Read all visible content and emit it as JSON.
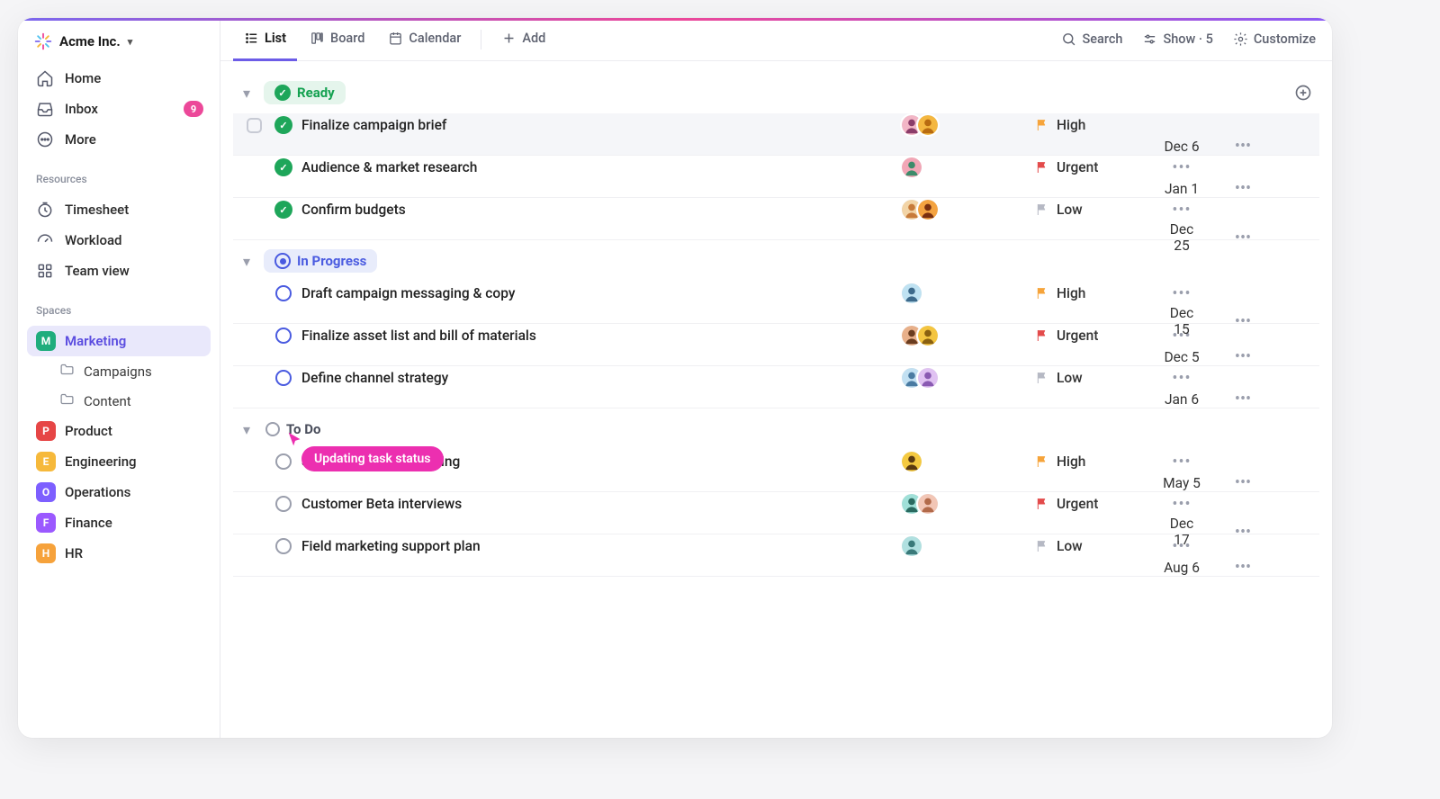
{
  "workspace": {
    "name": "Acme Inc."
  },
  "nav": {
    "home": "Home",
    "inbox": "Inbox",
    "inbox_badge": "9",
    "more": "More"
  },
  "sections": {
    "resources": "Resources",
    "spaces": "Spaces"
  },
  "resources": {
    "timesheet": "Timesheet",
    "workload": "Workload",
    "teamview": "Team view"
  },
  "spaces": [
    {
      "label": "Marketing",
      "initial": "M",
      "color": "#1fad7d",
      "active": true,
      "children": [
        "Campaigns",
        "Content"
      ]
    },
    {
      "label": "Product",
      "initial": "P",
      "color": "#e64646"
    },
    {
      "label": "Engineering",
      "initial": "E",
      "color": "#f6b93b"
    },
    {
      "label": "Operations",
      "initial": "O",
      "color": "#7d5fff"
    },
    {
      "label": "Finance",
      "initial": "F",
      "color": "#9b59ff"
    },
    {
      "label": "HR",
      "initial": "H",
      "color": "#f6a23b"
    }
  ],
  "toolbar": {
    "views": {
      "list": "List",
      "board": "Board",
      "calendar": "Calendar",
      "add": "Add"
    },
    "search": "Search",
    "show": "Show · 5",
    "customize": "Customize"
  },
  "groups": [
    {
      "key": "ready",
      "label": "Ready",
      "style": "ready",
      "icon": "check",
      "tasks": [
        {
          "title": "Finalize campaign brief",
          "avatars": [
            "#f2b6c6|#8b3d6a",
            "#f4b740|#b86b11"
          ],
          "priority": "High",
          "prio_color": "#f6a43b",
          "date": "Dec 6",
          "selected": true,
          "status": "done"
        },
        {
          "title": "Audience & market research",
          "avatars": [
            "#f2a6b6|#3d8b6a"
          ],
          "priority": "Urgent",
          "prio_color": "#e34b4b",
          "date": "Jan 1",
          "has_more": true,
          "status": "done"
        },
        {
          "title": "Confirm budgets",
          "avatars": [
            "#f2d4a6|#c77b3a",
            "#f4a340|#7a3010"
          ],
          "priority": "Low",
          "prio_color": "#b6b9c4",
          "date": "Dec 25",
          "has_more": true,
          "status": "done"
        }
      ]
    },
    {
      "key": "inprogress",
      "label": "In Progress",
      "style": "inprogress",
      "icon": "target",
      "tasks": [
        {
          "title": "Draft campaign messaging & copy",
          "avatars": [
            "#bfe2f2|#3d6a8b"
          ],
          "priority": "High",
          "prio_color": "#f6a43b",
          "date": "Dec 15",
          "has_more": true,
          "status": "ring-blue"
        },
        {
          "title": "Finalize asset list and bill of materials",
          "avatars": [
            "#e8b08a|#6a3d20",
            "#f4c540|#8a6010"
          ],
          "priority": "Urgent",
          "prio_color": "#e34b4b",
          "date": "Dec 5",
          "has_more": true,
          "status": "ring-blue"
        },
        {
          "title": "Define channel strategy",
          "avatars": [
            "#c2e0f2|#4a7ba2",
            "#e0c2f2|#8a5ab2"
          ],
          "priority": "Low",
          "prio_color": "#b6b9c4",
          "date": "Jan 6",
          "has_more": true,
          "status": "ring-blue"
        }
      ]
    },
    {
      "key": "todo",
      "label": "To Do",
      "style": "todo",
      "icon": "ring",
      "tasks": [
        {
          "title": "Schedule kickoff meeting",
          "avatars": [
            "#f4c940|#5a3a10"
          ],
          "priority": "High",
          "prio_color": "#f6a43b",
          "date": "May 5",
          "has_more": true,
          "status": "ring-gray"
        },
        {
          "title": "Customer Beta interviews",
          "avatars": [
            "#a0e0d8|#2a6a60",
            "#f2c6b6|#b26a4a"
          ],
          "priority": "Urgent",
          "prio_color": "#e34b4b",
          "date": "Dec 17",
          "has_more": true,
          "status": "ring-gray"
        },
        {
          "title": "Field marketing support plan",
          "avatars": [
            "#b0e0e0|#3a7a7a"
          ],
          "priority": "Low",
          "prio_color": "#b6b9c4",
          "date": "Aug 6",
          "has_more": true,
          "status": "ring-gray"
        }
      ]
    }
  ],
  "cursor_label": "Updating task status"
}
